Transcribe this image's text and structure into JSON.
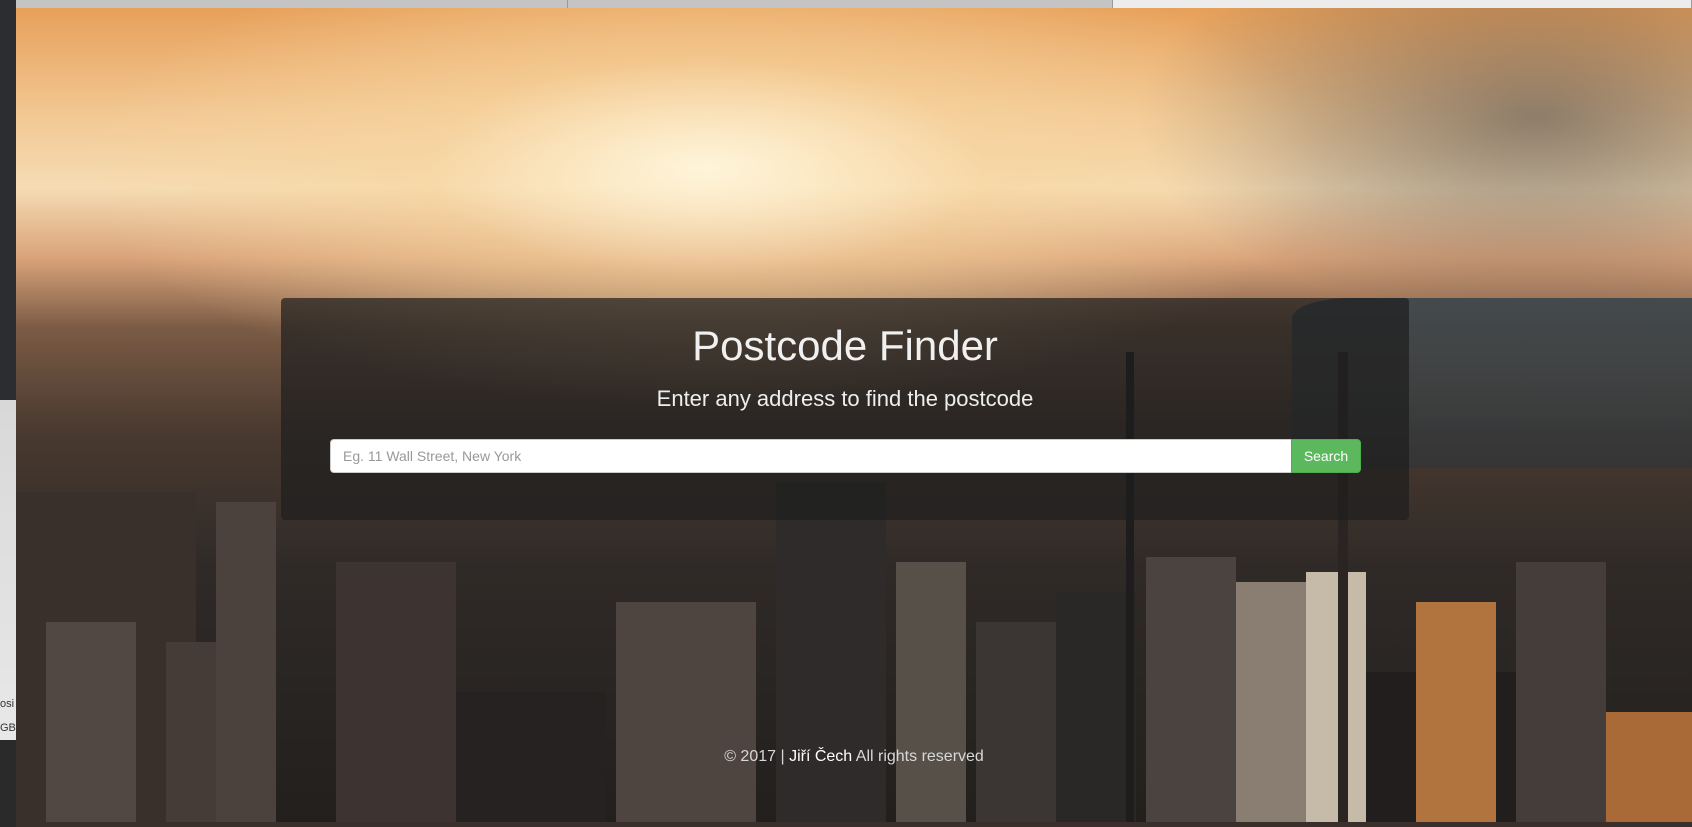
{
  "left_window": {
    "fragment_1": "osi",
    "fragment_2": "GB"
  },
  "hero": {
    "title": "Postcode Finder",
    "subtitle": "Enter any address to find the postcode",
    "search": {
      "placeholder": "Eg. 11 Wall Street, New York",
      "value": "",
      "button_label": "Search"
    }
  },
  "footer": {
    "prefix": "© 2017 |",
    "author": "Jiří Čech",
    "suffix": "All rights reserved"
  },
  "colors": {
    "search_button": "#5cb85c",
    "panel_overlay": "#1e1e1e"
  }
}
